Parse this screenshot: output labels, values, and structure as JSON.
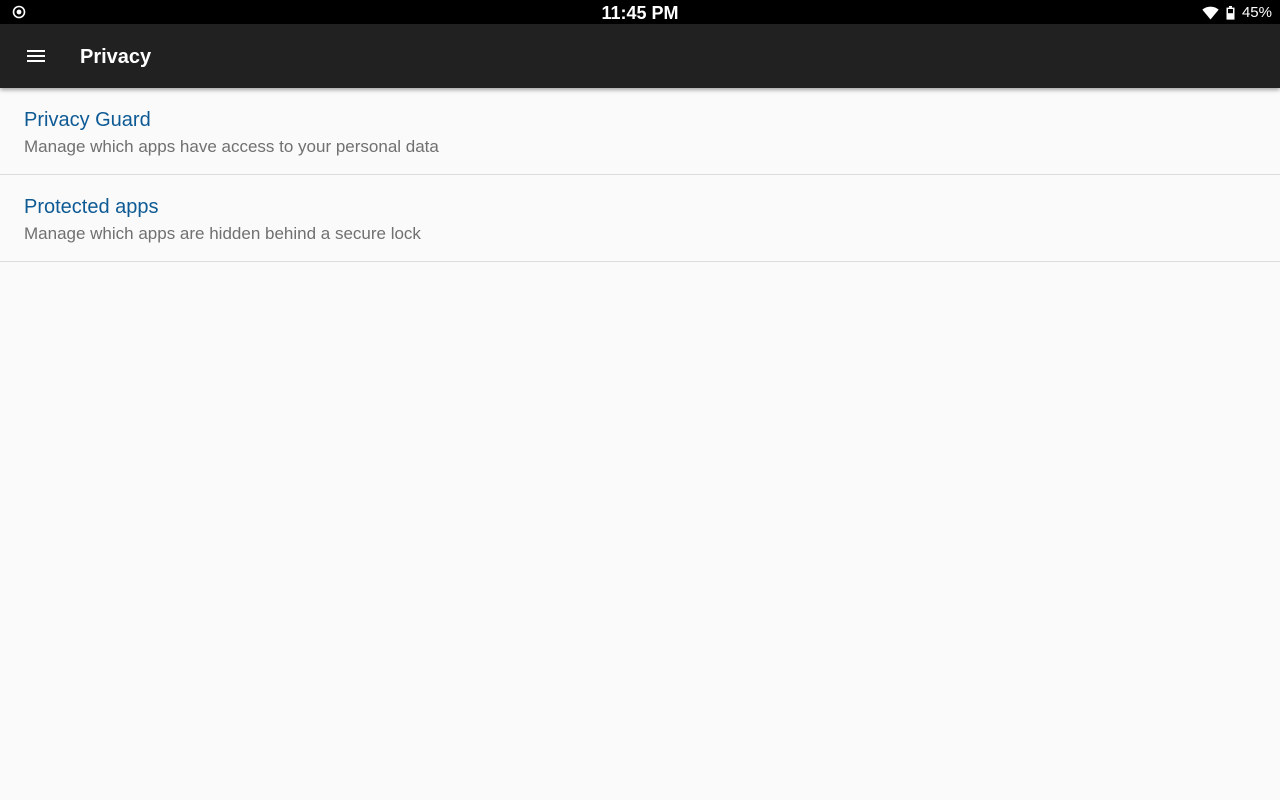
{
  "status_bar": {
    "time": "11:45 PM",
    "battery_percent": "45%",
    "left_icon": "record-circle-icon",
    "wifi_icon": "wifi-icon",
    "battery_icon": "battery-icon"
  },
  "toolbar": {
    "menu_icon": "hamburger-menu-icon",
    "title": "Privacy"
  },
  "preferences": [
    {
      "title": "Privacy Guard",
      "summary": "Manage which apps have access to your personal data"
    },
    {
      "title": "Protected apps",
      "summary": "Manage which apps are hidden behind a secure lock"
    }
  ],
  "colors": {
    "status_bar_bg": "#000000",
    "toolbar_bg": "#212121",
    "background": "#fafafa",
    "pref_title": "#0d5a94",
    "pref_summary": "#707070",
    "divider": "#dcdcdc"
  }
}
